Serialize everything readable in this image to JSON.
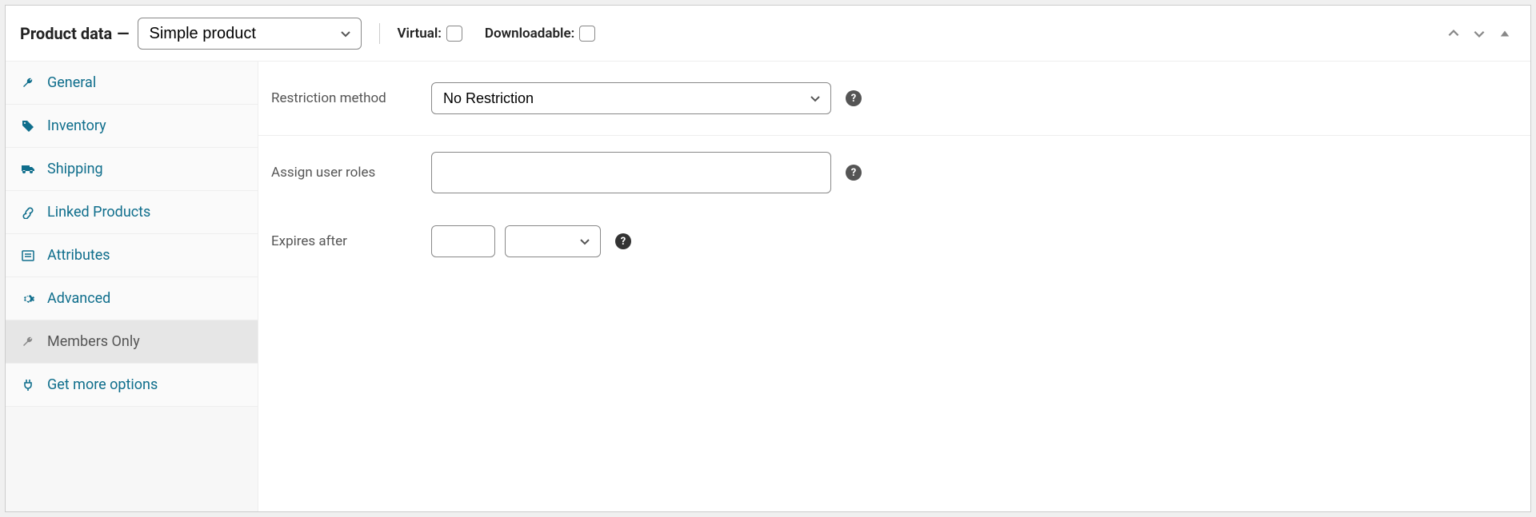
{
  "header": {
    "title": "Product data",
    "dash": "—",
    "type_selected": "Simple product",
    "virtual_label": "Virtual:",
    "downloadable_label": "Downloadable:"
  },
  "tabs": {
    "general": "General",
    "inventory": "Inventory",
    "shipping": "Shipping",
    "linked": "Linked Products",
    "attributes": "Attributes",
    "advanced": "Advanced",
    "members": "Members Only",
    "more": "Get more options"
  },
  "fields": {
    "restriction_label": "Restriction method",
    "restriction_value": "No Restriction",
    "assign_roles_label": "Assign user roles",
    "assign_roles_value": "",
    "expires_label": "Expires after",
    "expires_num": "",
    "expires_unit": ""
  }
}
